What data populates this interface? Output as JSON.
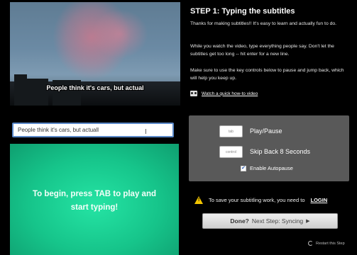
{
  "video": {
    "caption": "People think it's cars, but actual"
  },
  "subtitle_input": {
    "value": "People think it's cars, but actuall"
  },
  "start_panel": {
    "message": "To begin, press TAB to play and start typing!"
  },
  "step": {
    "title": "STEP 1: Typing the subtitles",
    "para1": "Thanks for making subtitles!! It's easy to learn and actually fun to do.",
    "para2": "While you watch the video, type everything people say. Don't let the subtitles get too long -- hit enter for a new line.",
    "para3": "Make sure to use the key controls below to pause and jump back, which will help you keep up.",
    "howto_link": "Watch a quick how-to video"
  },
  "controls": {
    "play_key": "tab",
    "play_label": "Play/Pause",
    "skip_key": "control",
    "skip_label": "Skip Back 8 Seconds",
    "autopause_label": "Enable Autopause",
    "autopause_checked": true
  },
  "login": {
    "text": "To save your subtitling work, you need to",
    "link": "LOGIN"
  },
  "done_button": {
    "bold": "Done?",
    "label": "Next Step: Syncing",
    "arrow": "▶"
  },
  "restart": {
    "label": "Restart this Step"
  },
  "colors": {
    "green_panel": "#16c48a",
    "controls_bg": "#595959",
    "input_border": "#5a88c8",
    "warning": "#f3c500"
  }
}
